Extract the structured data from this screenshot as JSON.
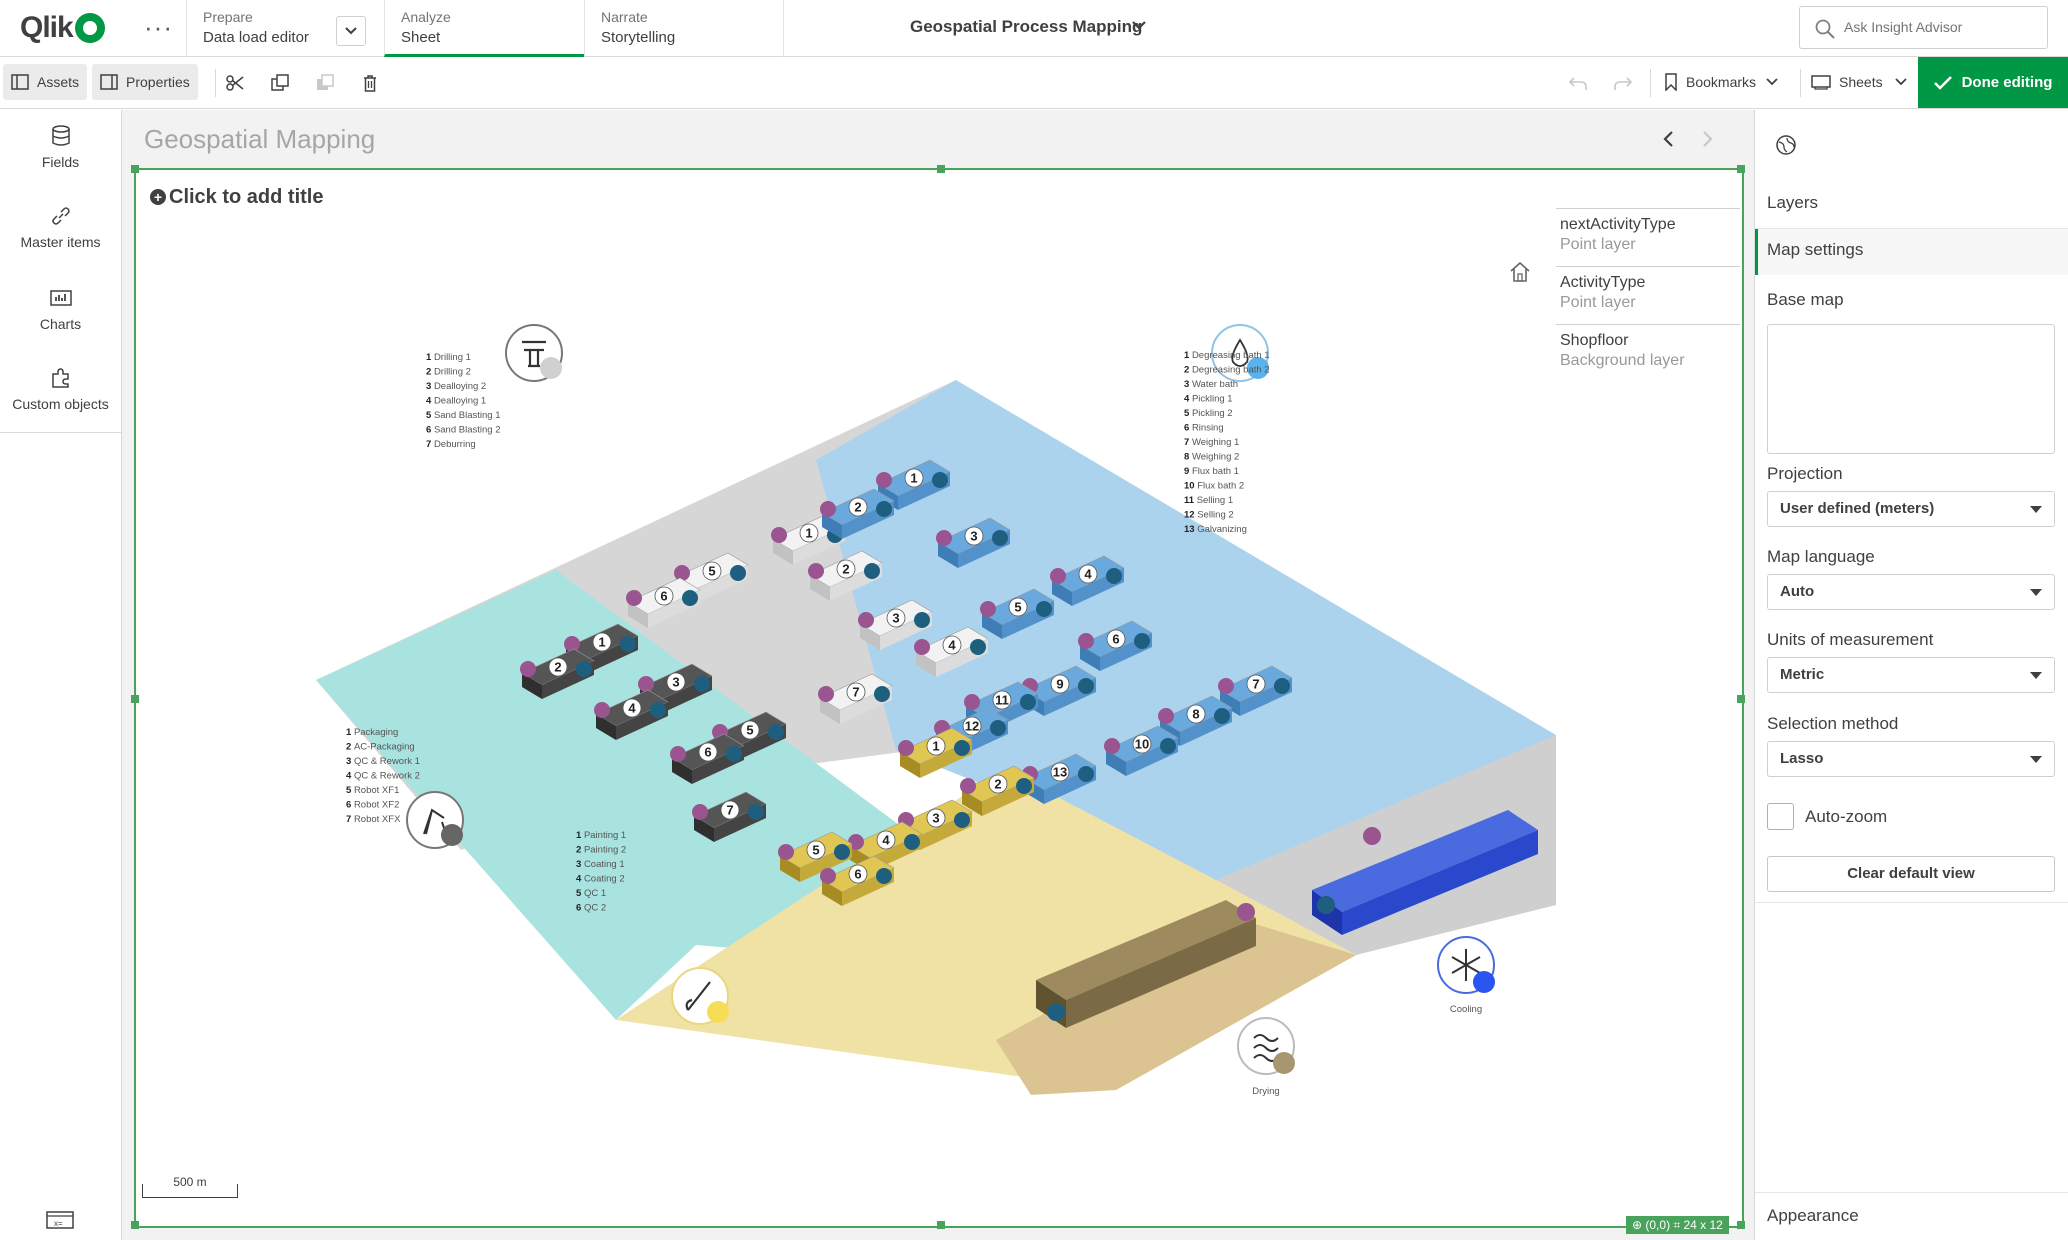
{
  "header": {
    "logo": "Qlik",
    "more": "···",
    "tabs": [
      {
        "sub": "Prepare",
        "main": "Data load editor"
      },
      {
        "sub": "Analyze",
        "main": "Sheet"
      },
      {
        "sub": "Narrate",
        "main": "Storytelling"
      }
    ],
    "app_title": "Geospatial Process Mapping",
    "search_placeholder": "Ask Insight Advisor"
  },
  "toolbar": {
    "assets": "Assets",
    "properties": "Properties",
    "bookmarks": "Bookmarks",
    "sheets": "Sheets",
    "done": "Done editing"
  },
  "left_panel": {
    "items": [
      "Fields",
      "Master items",
      "Charts",
      "Custom objects"
    ]
  },
  "sheet": {
    "title": "Geospatial Mapping",
    "add_title": "Click to add title",
    "scale": "500 m",
    "grid_badge": "⊕ (0,0) ⌗ 24 x 12"
  },
  "legend": [
    {
      "name": "nextActivityType",
      "type": "Point layer"
    },
    {
      "name": "ActivityType",
      "type": "Point layer"
    },
    {
      "name": "Shopfloor",
      "type": "Background layer"
    }
  ],
  "areas": {
    "machining": {
      "color": "#d6d6d6",
      "items": [
        "Drilling 1",
        "Drilling 2",
        "Dealloying 2",
        "Dealloying 1",
        "Sand Blasting 1",
        "Sand Blasting 2",
        "Deburring"
      ]
    },
    "treatment": {
      "color": "#acd3ee",
      "items": [
        "Degreasing bath 1",
        "Degreasing bath 2",
        "Water bath",
        "Pickling 1",
        "Pickling 2",
        "Rinsing",
        "Weighing 1",
        "Weighing 2",
        "Flux bath 1",
        "Flux bath 2",
        "Selling 1",
        "Selling 2",
        "Galvanizing"
      ]
    },
    "packaging": {
      "color": "#a9e3df",
      "items": [
        "Packaging",
        "AC-Packaging",
        "QC & Rework 1",
        "QC & Rework 2",
        "Robot XF1",
        "Robot XF2",
        "Robot XFX"
      ]
    },
    "painting": {
      "color": "#f0e1a4",
      "items": [
        "Painting 1",
        "Painting 2",
        "Coating 1",
        "Coating 2",
        "QC 1",
        "QC 2"
      ]
    },
    "cooling": {
      "label": "Cooling",
      "color": "#2a48cc"
    },
    "drying": {
      "label": "Drying",
      "color": "#7a6a46"
    }
  },
  "point_colors": {
    "activity": "#1e5f80",
    "next_activity": "#9a5590"
  },
  "right_panel": {
    "sections": [
      "Layers",
      "Map settings"
    ],
    "base_map_label": "Base map",
    "projection_label": "Projection",
    "projection_value": "User defined (meters)",
    "language_label": "Map language",
    "language_value": "Auto",
    "units_label": "Units of measurement",
    "units_value": "Metric",
    "selection_label": "Selection method",
    "selection_value": "Lasso",
    "autozoom_label": "Auto-zoom",
    "clear_view": "Clear default view",
    "appearance": "Appearance"
  }
}
